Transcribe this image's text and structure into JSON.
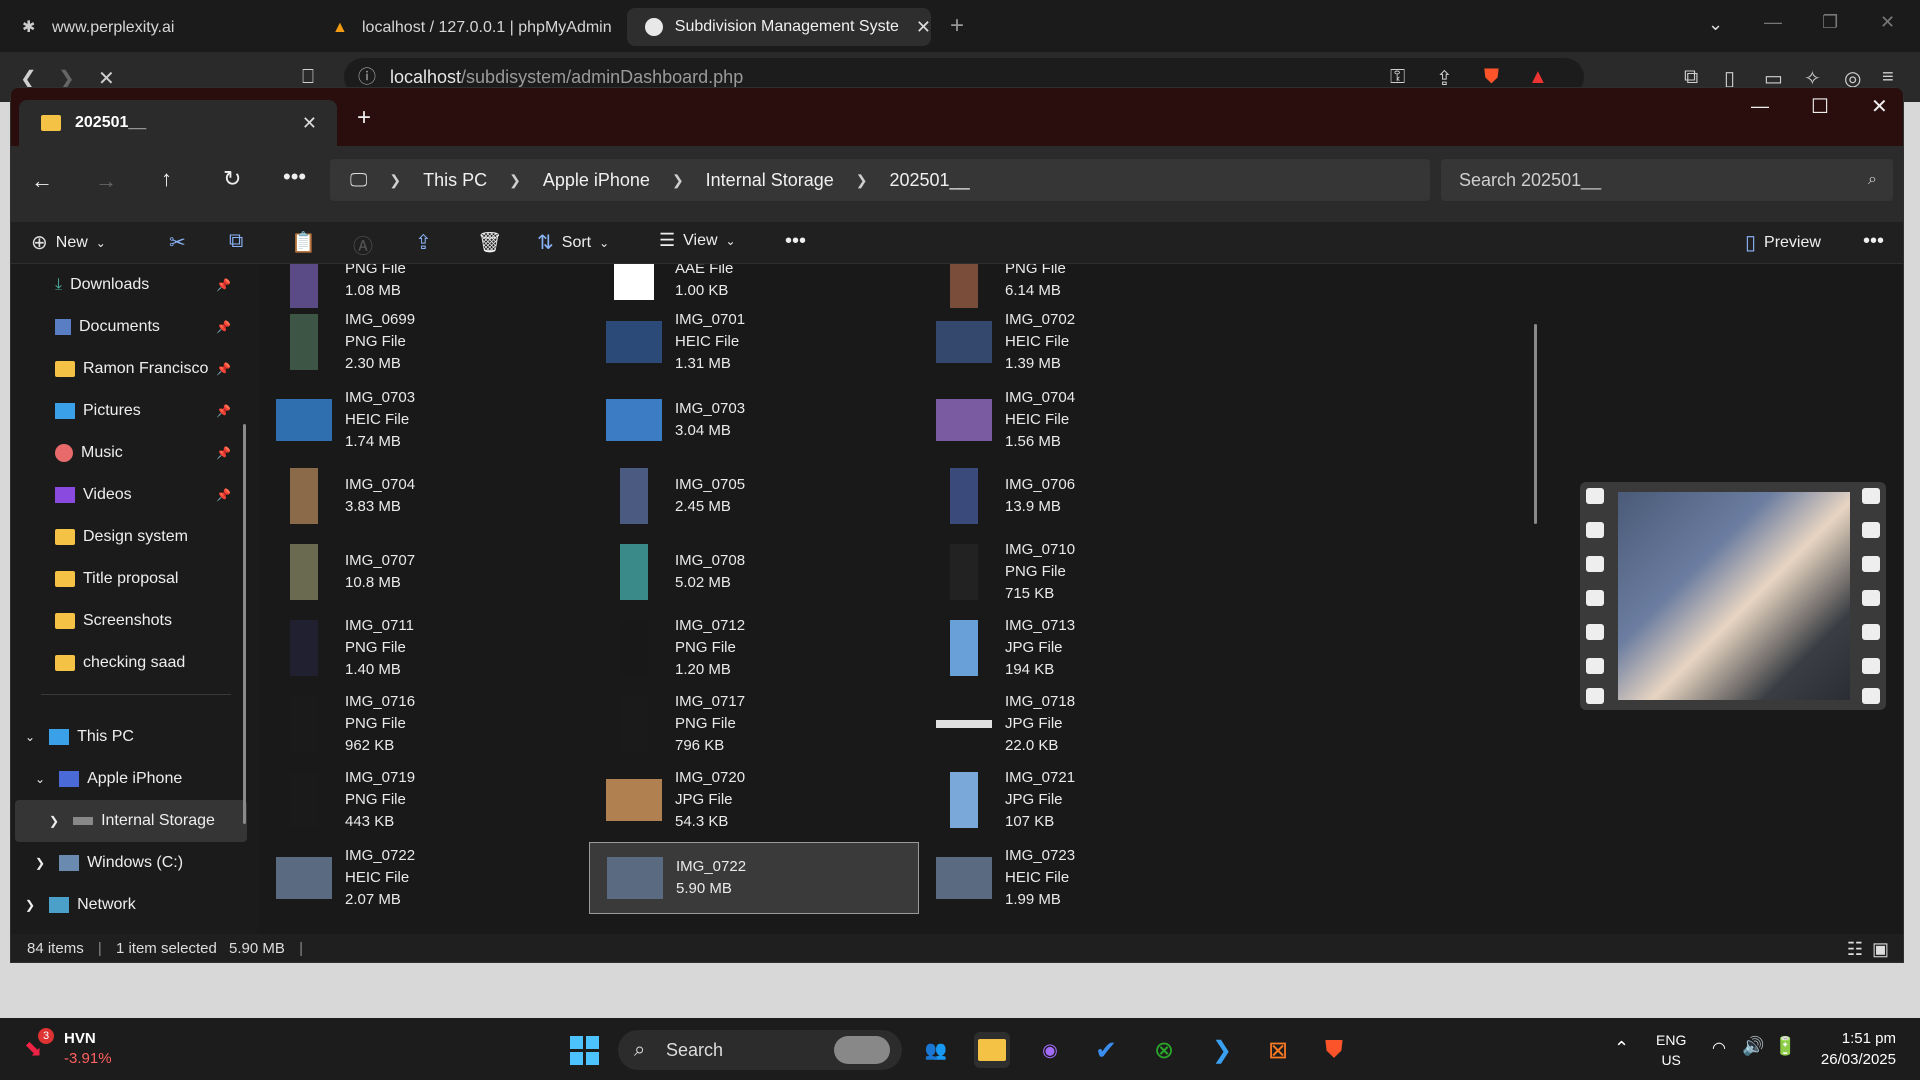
{
  "browser": {
    "tabs": [
      {
        "title": "www.perplexity.ai"
      },
      {
        "title": "localhost / 127.0.0.1 | phpMyAdmin"
      },
      {
        "title": "Subdivision Management Syste"
      }
    ],
    "url_host": "localhost",
    "url_path": "/subdisystem/adminDashboard.php"
  },
  "explorer": {
    "tab_title": "202501__",
    "breadcrumb": [
      "This PC",
      "Apple iPhone",
      "Internal Storage",
      "202501__"
    ],
    "search_placeholder": "Search 202501__",
    "cmd": {
      "new": "New",
      "sort": "Sort",
      "view": "View",
      "preview": "Preview"
    },
    "nav": {
      "quick": [
        {
          "label": "Downloads",
          "icon": "download-icon"
        },
        {
          "label": "Documents",
          "icon": "document-icon"
        },
        {
          "label": "Ramon Francisco",
          "icon": "folder-icon"
        },
        {
          "label": "Pictures",
          "icon": "pictures-icon"
        },
        {
          "label": "Music",
          "icon": "music-icon"
        },
        {
          "label": "Videos",
          "icon": "videos-icon"
        },
        {
          "label": "Design system",
          "icon": "folder-icon"
        },
        {
          "label": "Title proposal",
          "icon": "folder-icon"
        },
        {
          "label": "Screenshots",
          "icon": "folder-icon"
        },
        {
          "label": "checking saad",
          "icon": "folder-icon"
        }
      ],
      "tree": [
        {
          "label": "This PC"
        },
        {
          "label": "Apple iPhone"
        },
        {
          "label": "Internal Storage"
        },
        {
          "label": "Windows (C:)"
        },
        {
          "label": "Network"
        }
      ]
    },
    "files": [
      {
        "name": "",
        "type": "PNG File",
        "size": "1.08 MB",
        "color": "#5a4a86"
      },
      {
        "name": "",
        "type": "AAE File",
        "size": "1.00 KB",
        "color": "#ffffff"
      },
      {
        "name": "",
        "type": "PNG File",
        "size": "6.14 MB",
        "color": "#7a4d3a"
      },
      {
        "name": "IMG_0699",
        "type": "PNG File",
        "size": "2.30 MB",
        "color": "#3c5544"
      },
      {
        "name": "IMG_0701",
        "type": "HEIC File",
        "size": "1.31 MB",
        "color": "#2c4a78"
      },
      {
        "name": "IMG_0702",
        "type": "HEIC File",
        "size": "1.39 MB",
        "color": "#34486e"
      },
      {
        "name": "IMG_0703",
        "type": "HEIC File",
        "size": "1.74 MB",
        "color": "#2f6fb0"
      },
      {
        "name": "IMG_0703",
        "type": "",
        "size": "3.04 MB",
        "color": "#3b7cc4"
      },
      {
        "name": "IMG_0704",
        "type": "HEIC File",
        "size": "1.56 MB",
        "color": "#7a5aa0"
      },
      {
        "name": "IMG_0704",
        "type": "",
        "size": "3.83 MB",
        "color": "#8a6a48"
      },
      {
        "name": "IMG_0705",
        "type": "",
        "size": "2.45 MB",
        "color": "#4a5a80"
      },
      {
        "name": "IMG_0706",
        "type": "",
        "size": "13.9 MB",
        "color": "#3a4a7a"
      },
      {
        "name": "IMG_0707",
        "type": "",
        "size": "10.8 MB",
        "color": "#6a6a50"
      },
      {
        "name": "IMG_0708",
        "type": "",
        "size": "5.02 MB",
        "color": "#3a8a8a"
      },
      {
        "name": "IMG_0710",
        "type": "PNG File",
        "size": "715 KB",
        "color": "#222222"
      },
      {
        "name": "IMG_0711",
        "type": "PNG File",
        "size": "1.40 MB",
        "color": "#202030"
      },
      {
        "name": "IMG_0712",
        "type": "PNG File",
        "size": "1.20 MB",
        "color": "#181818"
      },
      {
        "name": "IMG_0713",
        "type": "JPG File",
        "size": "194 KB",
        "color": "#6aa0d8"
      },
      {
        "name": "IMG_0716",
        "type": "PNG File",
        "size": "962 KB",
        "color": "#1a1a1a"
      },
      {
        "name": "IMG_0717",
        "type": "PNG File",
        "size": "796 KB",
        "color": "#1a1a1a"
      },
      {
        "name": "IMG_0718",
        "type": "JPG File",
        "size": "22.0 KB",
        "color": "#e0e0e0"
      },
      {
        "name": "IMG_0719",
        "type": "PNG File",
        "size": "443 KB",
        "color": "#1a1a1a"
      },
      {
        "name": "IMG_0720",
        "type": "JPG File",
        "size": "54.3 KB",
        "color": "#b08050"
      },
      {
        "name": "IMG_0721",
        "type": "JPG File",
        "size": "107 KB",
        "color": "#7aa8d8"
      },
      {
        "name": "IMG_0722",
        "type": "HEIC File",
        "size": "2.07 MB",
        "color": "#5a6a80"
      },
      {
        "name": "IMG_0722",
        "type": "",
        "size": "5.90 MB",
        "color": "#5a6a80"
      },
      {
        "name": "IMG_0723",
        "type": "HEIC File",
        "size": "1.99 MB",
        "color": "#5a6a80"
      }
    ],
    "status": {
      "count": "84 items",
      "selected": "1 item selected",
      "size": "5.90 MB"
    }
  },
  "taskbar": {
    "stock_badge": "3",
    "stock_name": "HVN",
    "stock_change": "-3.91%",
    "search": "Search",
    "lang": "ENG",
    "region": "US",
    "time": "1:51 pm",
    "date": "26/03/2025"
  }
}
